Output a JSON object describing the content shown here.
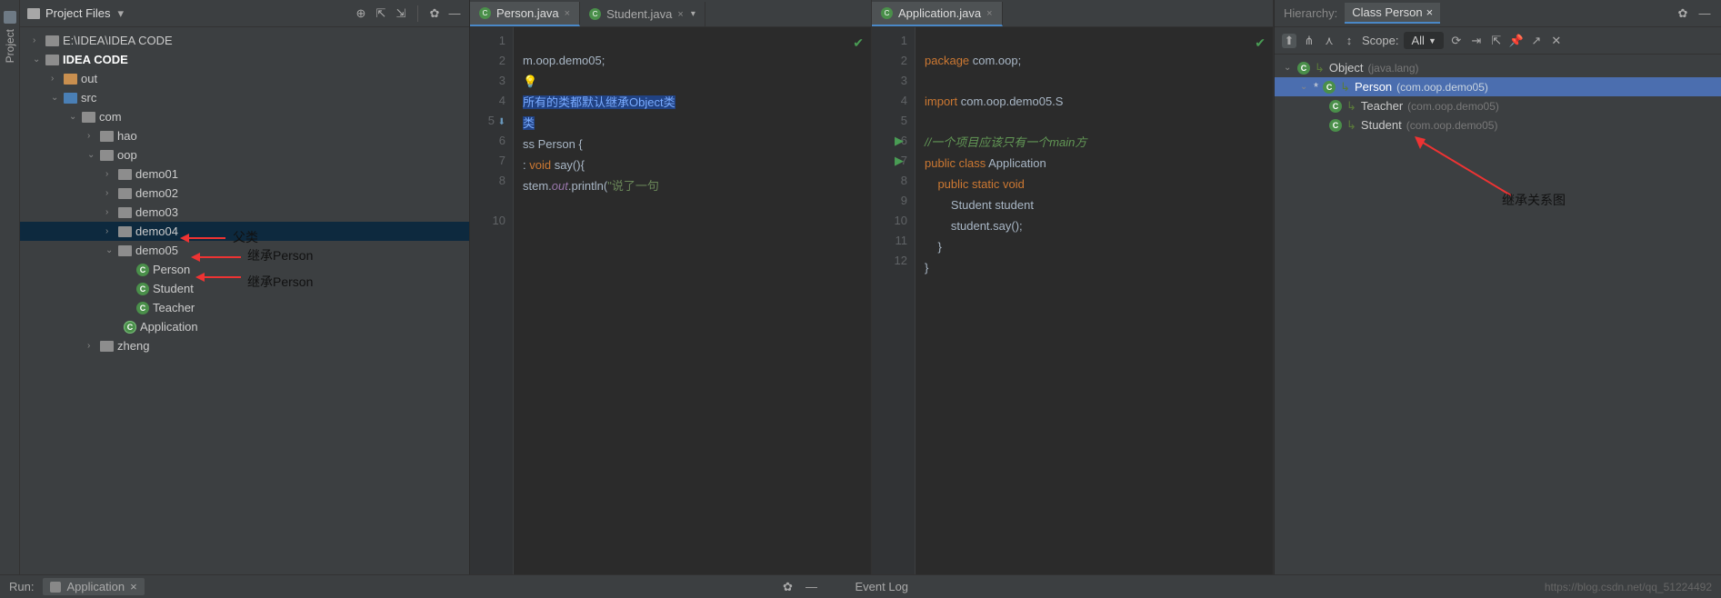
{
  "leftStrip": {
    "label": "Project"
  },
  "projectPanel": {
    "title": "Project Files",
    "tree": {
      "root1": "E:\\IDEA\\IDEA CODE",
      "root2": "IDEA CODE",
      "out": "out",
      "src": "src",
      "com": "com",
      "hao": "hao",
      "oop": "oop",
      "demo01": "demo01",
      "demo02": "demo02",
      "demo03": "demo03",
      "demo04": "demo04",
      "demo05": "demo05",
      "person": "Person",
      "student": "Student",
      "teacher": "Teacher",
      "application": "Application",
      "zheng": "zheng"
    }
  },
  "annotations": {
    "parent": "父类",
    "inherit1": "继承Person",
    "inherit2": "继承Person",
    "hierarchy": "继承关系图"
  },
  "editor1": {
    "tabs": {
      "t1": "Person.java",
      "t2": "Student.java"
    },
    "lines": {
      "l1": "m.oop.demo05;",
      "l3a": "所有的类都默认继承Object类",
      "l4a": "类",
      "l5": "ss Person {",
      "l6a": ": ",
      "l6b": "void",
      "l6c": " say(){",
      "l7a": "stem.",
      "l7b": "out",
      "l7c": ".println(",
      "l7d": "\"说了一句"
    }
  },
  "editor2": {
    "tabs": {
      "t1": "Application.java"
    },
    "lines": {
      "l1a": "package ",
      "l1b": "com.oop;",
      "l3a": "import ",
      "l3b": "com.oop.demo05.S",
      "l5": "//一个项目应该只有一个main方",
      "l6a": "public class ",
      "l6b": "Application",
      "l7a": "    public static void ",
      "l8": "        Student student",
      "l9": "        student.say();",
      "l10": "    }",
      "l11": "}"
    }
  },
  "hierarchy": {
    "title": "Hierarchy:",
    "tab": "Class Person",
    "scope": "Scope:",
    "scopeVal": "All",
    "tree": {
      "object": "Object",
      "objectPkg": "(java.lang)",
      "person": "Person",
      "personPkg": "(com.oop.demo05)",
      "teacher": "Teacher",
      "teacherPkg": "(com.oop.demo05)",
      "student": "Student",
      "studentPkg": "(com.oop.demo05)"
    }
  },
  "bottom": {
    "run": "Run:",
    "app": "Application",
    "eventLog": "Event Log",
    "url": "https://blog.csdn.net/qq_51224492"
  }
}
